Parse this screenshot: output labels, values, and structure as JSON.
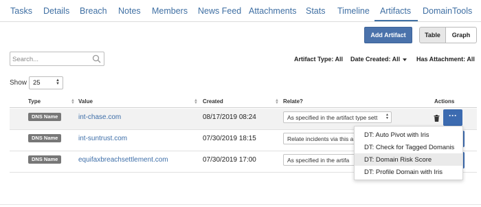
{
  "tabs": [
    "Tasks",
    "Details",
    "Breach",
    "Notes",
    "Members",
    "News Feed",
    "Attachments",
    "Stats",
    "Timeline",
    "Artifacts",
    "DomainTools"
  ],
  "active_tab": "Artifacts",
  "toolbar": {
    "add_label": "Add Artifact",
    "table_label": "Table",
    "graph_label": "Graph",
    "active_view": "Table"
  },
  "search": {
    "placeholder": "Search...",
    "value": ""
  },
  "filters": {
    "artifact_type": "Artifact Type: All",
    "date_created": "Date Created: All",
    "has_attachment": "Has Attachment: All"
  },
  "show": {
    "label": "Show",
    "value": "25"
  },
  "table": {
    "headers": {
      "type": "Type",
      "value": "Value",
      "created": "Created",
      "relate": "Relate?",
      "actions": "Actions"
    },
    "rows": [
      {
        "type": "DNS Name",
        "value": "int-chase.com",
        "created": "08/17/2019 08:24",
        "relate": "As specified in the artifact type sett"
      },
      {
        "type": "DNS Name",
        "value": "int-suntrust.com",
        "created": "07/30/2019 18:15",
        "relate": "Relate incidents via this a"
      },
      {
        "type": "DNS Name",
        "value": "equifaxbreachsettlement.com",
        "created": "07/30/2019 17:00",
        "relate": "As specified in the artifa"
      }
    ]
  },
  "more_label": "···",
  "action_menu": {
    "items": [
      "DT: Auto Pivot with Iris",
      "DT: Check for Tagged Domanis",
      "DT: Domain Risk Score",
      "DT: Profile Domain with Iris"
    ],
    "highlighted": "DT: Domain Risk Score"
  },
  "colors": {
    "accent": "#3f6fa3",
    "button": "#4a72ab",
    "badge": "#777777"
  }
}
